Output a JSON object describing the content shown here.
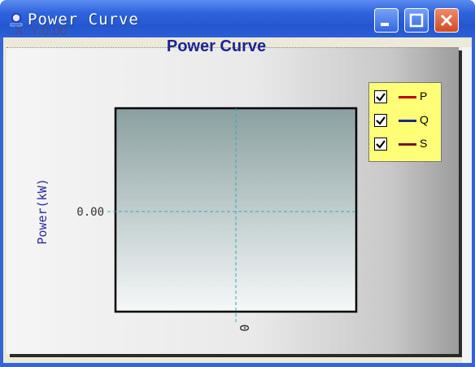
{
  "window": {
    "title": "Power Curve"
  },
  "readout": {
    "text": "X: Y:0.00"
  },
  "chart_data": {
    "type": "line",
    "title": "Power Curve",
    "xlabel": "",
    "ylabel": "Power(kW)",
    "x_ticks": [
      "0"
    ],
    "y_ticks": [
      "0.00"
    ],
    "series": [
      {
        "name": "P",
        "values": [],
        "color": "#c0000c"
      },
      {
        "name": "Q",
        "values": [],
        "color": "#1f2a86"
      },
      {
        "name": "S",
        "values": [],
        "color": "#6b1a26"
      }
    ],
    "grid": false,
    "crosshair": {
      "x": 0,
      "y": 0.0
    },
    "legend_position": "top-right",
    "background": {
      "top": "#8aa0a0",
      "bottom": "#f6f8f9"
    }
  },
  "legend": {
    "items": [
      {
        "label": "P",
        "checked": true,
        "color": "#c0000c"
      },
      {
        "label": "Q",
        "checked": true,
        "color": "#1f2a86"
      },
      {
        "label": "S",
        "checked": true,
        "color": "#6b1a26"
      }
    ]
  }
}
